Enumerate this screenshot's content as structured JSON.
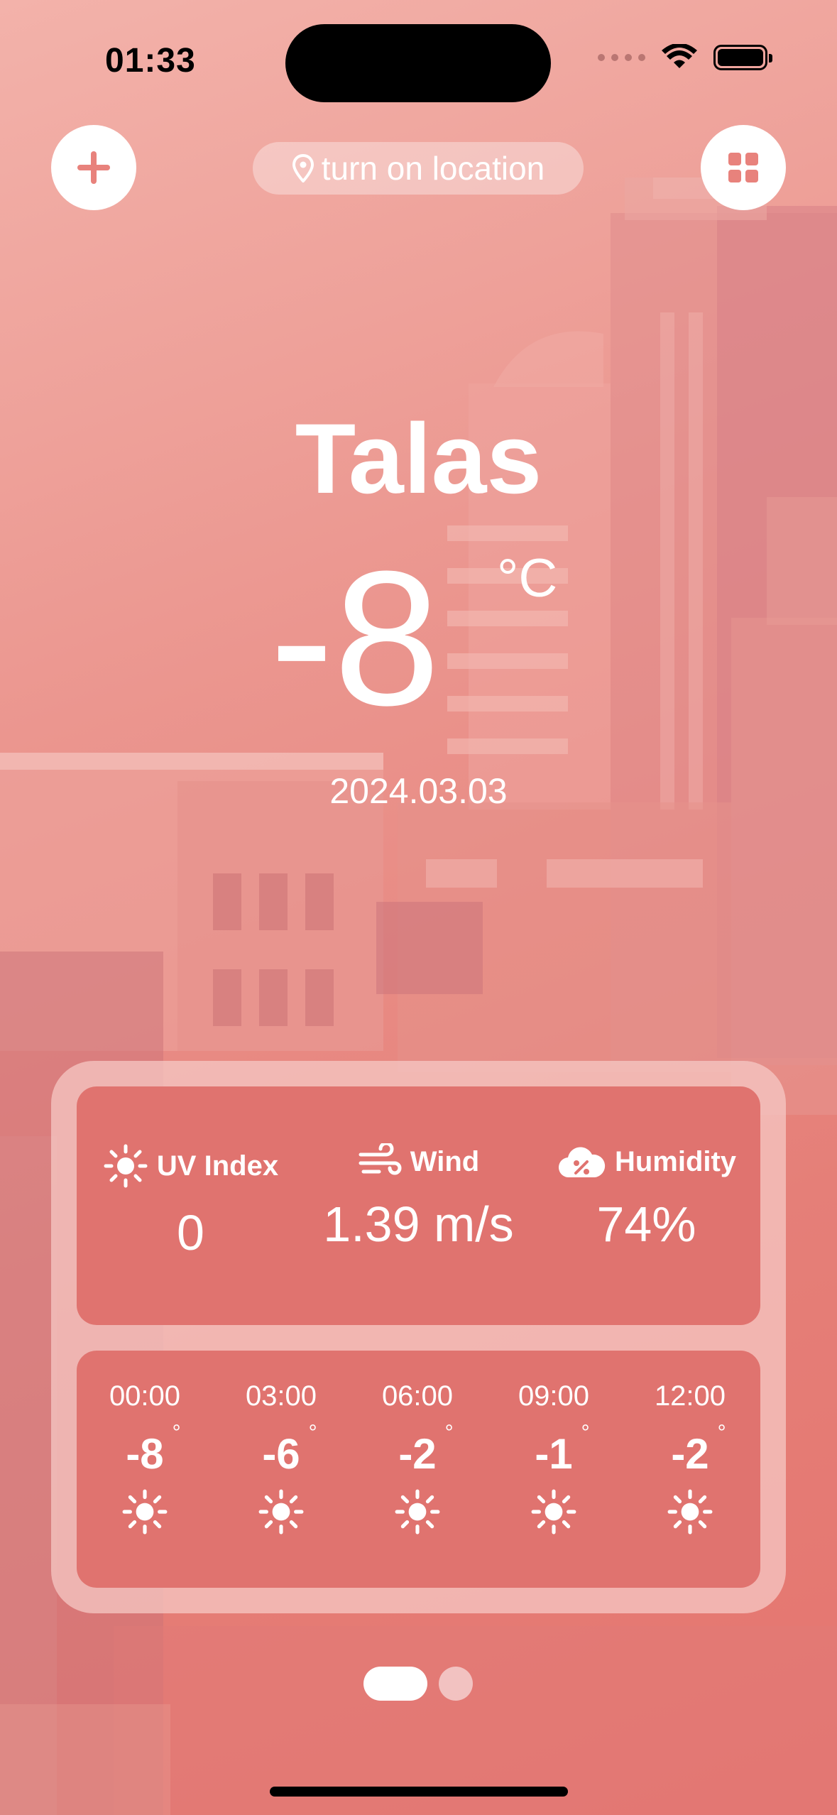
{
  "status_bar": {
    "time": "01:33"
  },
  "top_bar": {
    "location_label": "turn on location"
  },
  "weather": {
    "city": "Talas",
    "temperature": "-8",
    "unit": "°C",
    "date": "2024.03.03"
  },
  "stats": [
    {
      "label": "UV Index",
      "value": "0",
      "icon": "sun-icon"
    },
    {
      "label": "Wind",
      "value": "1.39 m/s",
      "icon": "wind-icon"
    },
    {
      "label": "Humidity",
      "value": "74%",
      "icon": "humidity-cloud-icon"
    }
  ],
  "hourly": [
    {
      "time": "00:00",
      "temp": "-8",
      "deg": "°",
      "icon": "sun-icon"
    },
    {
      "time": "03:00",
      "temp": "-6",
      "deg": "°",
      "icon": "sun-icon"
    },
    {
      "time": "06:00",
      "temp": "-2",
      "deg": "°",
      "icon": "sun-icon"
    },
    {
      "time": "09:00",
      "temp": "-1",
      "deg": "°",
      "icon": "sun-icon"
    },
    {
      "time": "12:00",
      "temp": "-2",
      "deg": "°",
      "icon": "sun-icon"
    }
  ],
  "colors": {
    "accent": "#e0736f",
    "card": "#f5c8c4",
    "background": "#eb968f"
  }
}
